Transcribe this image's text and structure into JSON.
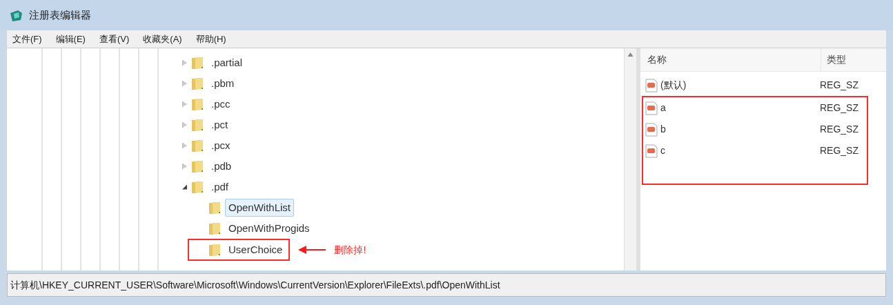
{
  "window": {
    "title": "注册表编辑器"
  },
  "menu": [
    "文件(F)",
    "编辑(E)",
    "查看(V)",
    "收藏夹(A)",
    "帮助(H)"
  ],
  "tree": [
    {
      "label": ".partial",
      "expanded": false,
      "selected": false
    },
    {
      "label": ".pbm",
      "expanded": false,
      "selected": false
    },
    {
      "label": ".pcc",
      "expanded": false,
      "selected": false
    },
    {
      "label": ".pct",
      "expanded": false,
      "selected": false
    },
    {
      "label": ".pcx",
      "expanded": false,
      "selected": false
    },
    {
      "label": ".pdb",
      "expanded": false,
      "selected": false
    },
    {
      "label": ".pdf",
      "expanded": true,
      "selected": false,
      "children": [
        {
          "label": "OpenWithList",
          "selected": true
        },
        {
          "label": "OpenWithProgids",
          "selected": false
        },
        {
          "label": "UserChoice",
          "selected": false,
          "marked": true,
          "annotation": "删除掉!"
        }
      ]
    }
  ],
  "values": {
    "columns": [
      "名称",
      "类型"
    ],
    "rows": [
      {
        "name": "(默认)",
        "type": "REG_SZ",
        "marked": false
      },
      {
        "name": "a",
        "type": "REG_SZ",
        "marked": true
      },
      {
        "name": "b",
        "type": "REG_SZ",
        "marked": true
      },
      {
        "name": "c",
        "type": "REG_SZ",
        "marked": true
      }
    ]
  },
  "status_bar": "计算机\\HKEY_CURRENT_USER\\Software\\Microsoft\\Windows\\CurrentVersion\\Explorer\\FileExts\\.pdf\\OpenWithList"
}
